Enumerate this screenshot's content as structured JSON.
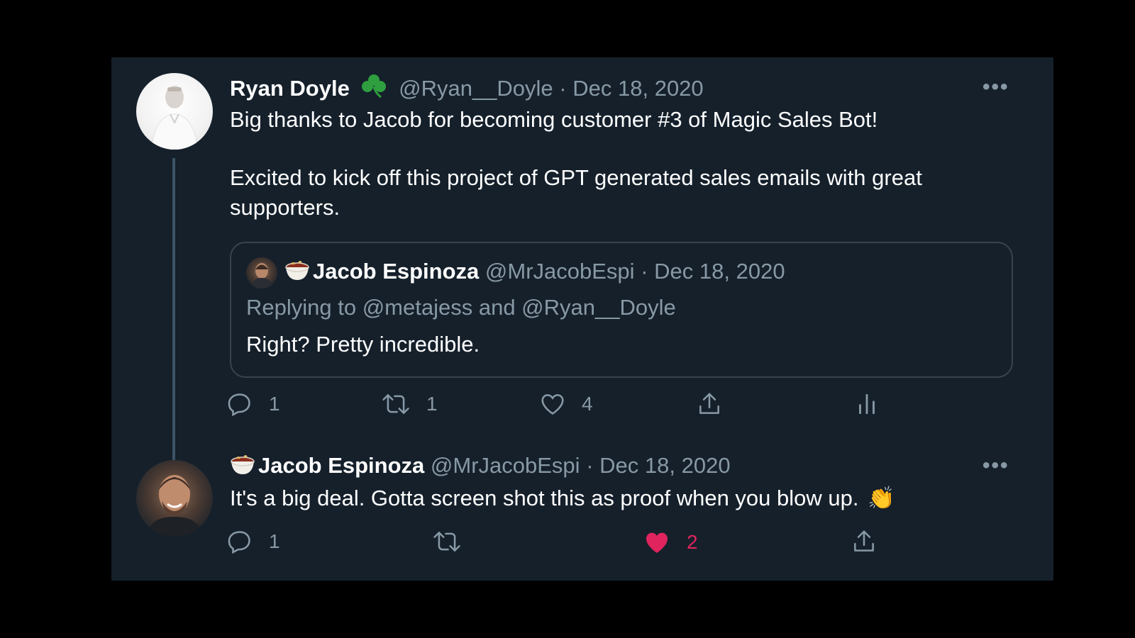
{
  "tweet": {
    "author_name": "Ryan Doyle",
    "author_emoji": "☘️",
    "handle": "@Ryan__Doyle",
    "separator": "·",
    "date": "Dec 18, 2020",
    "body_line1": "Big thanks to Jacob for becoming customer #3 of Magic Sales Bot!",
    "body_line2": "Excited to kick off this project of GPT generated sales emails with great",
    "body_line3": "supporters.",
    "more_label": "•••",
    "actions": {
      "reply_count": "1",
      "retweet_count": "1",
      "like_count": "4"
    }
  },
  "quote": {
    "author_name": "Jacob Espinoza",
    "handle": "@MrJacobEspi",
    "separator": "·",
    "date": "Dec 18, 2020",
    "replying_to": "Replying to @metajess and @Ryan__Doyle",
    "body": "Right? Pretty incredible."
  },
  "reply": {
    "author_name": "Jacob Espinoza",
    "handle": "@MrJacobEspi",
    "separator": "·",
    "date": "Dec 18, 2020",
    "body": "It's a big deal. Gotta screen shot this as proof when you blow up.",
    "body_emoji": "👏",
    "more_label": "•••",
    "actions": {
      "reply_count": "1",
      "like_count": "2"
    }
  },
  "colors": {
    "background": "#000000",
    "card": "#15202b",
    "muted_text": "#8899a6",
    "border": "#38444d",
    "like_active": "#e0245e",
    "shamrock": "#2e9e3f"
  },
  "icons": [
    "reply-icon",
    "retweet-icon",
    "like-icon",
    "share-icon",
    "analytics-icon",
    "more-icon",
    "shamrock-icon",
    "bowl-icon",
    "clap-icon"
  ]
}
